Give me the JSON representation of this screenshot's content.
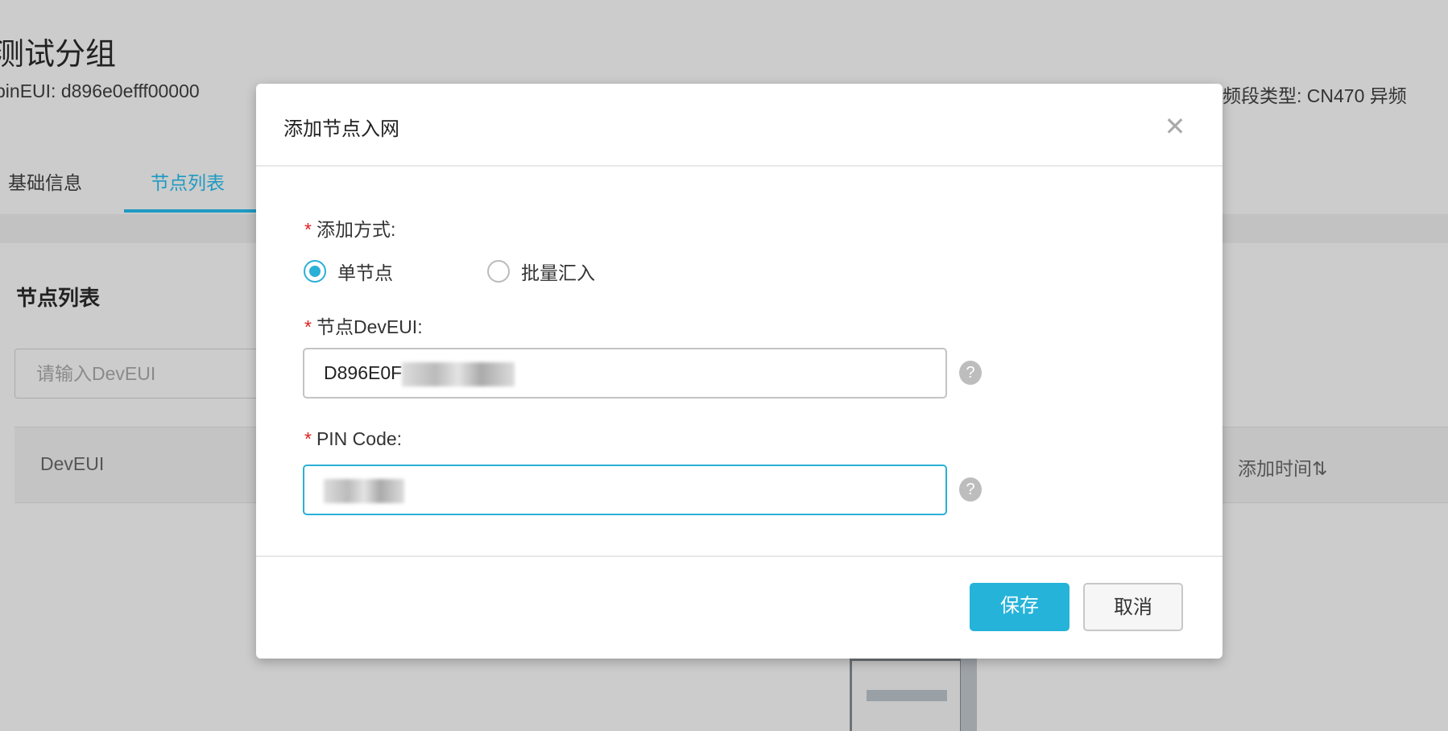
{
  "page": {
    "title": "测试分组",
    "pin_eui_label": "pinEUI:",
    "pin_eui_value": "d896e0efff00000",
    "band_type": "频段类型: CN470 异频",
    "tabs": [
      {
        "label": "基础信息"
      },
      {
        "label": "节点列表"
      }
    ],
    "section_title": "节点列表",
    "search_placeholder": "请输入DevEUI",
    "table_headers": [
      "DevEUI",
      "添加时间"
    ],
    "sort_icon": "⇅"
  },
  "modal": {
    "title": "添加节点入网",
    "close": "✕",
    "add_method_label": "添加方式:",
    "radio_options": [
      {
        "label": "单节点",
        "selected": true
      },
      {
        "label": "批量汇入",
        "selected": false
      }
    ],
    "deveui_label": "节点DevEUI:",
    "deveui_value": "D896E0F",
    "pin_label": "PIN Code:",
    "help": "?",
    "save": "保存",
    "cancel": "取消",
    "required_mark": "*"
  },
  "colors": {
    "accent": "#25b3d9",
    "required": "#e02020"
  }
}
